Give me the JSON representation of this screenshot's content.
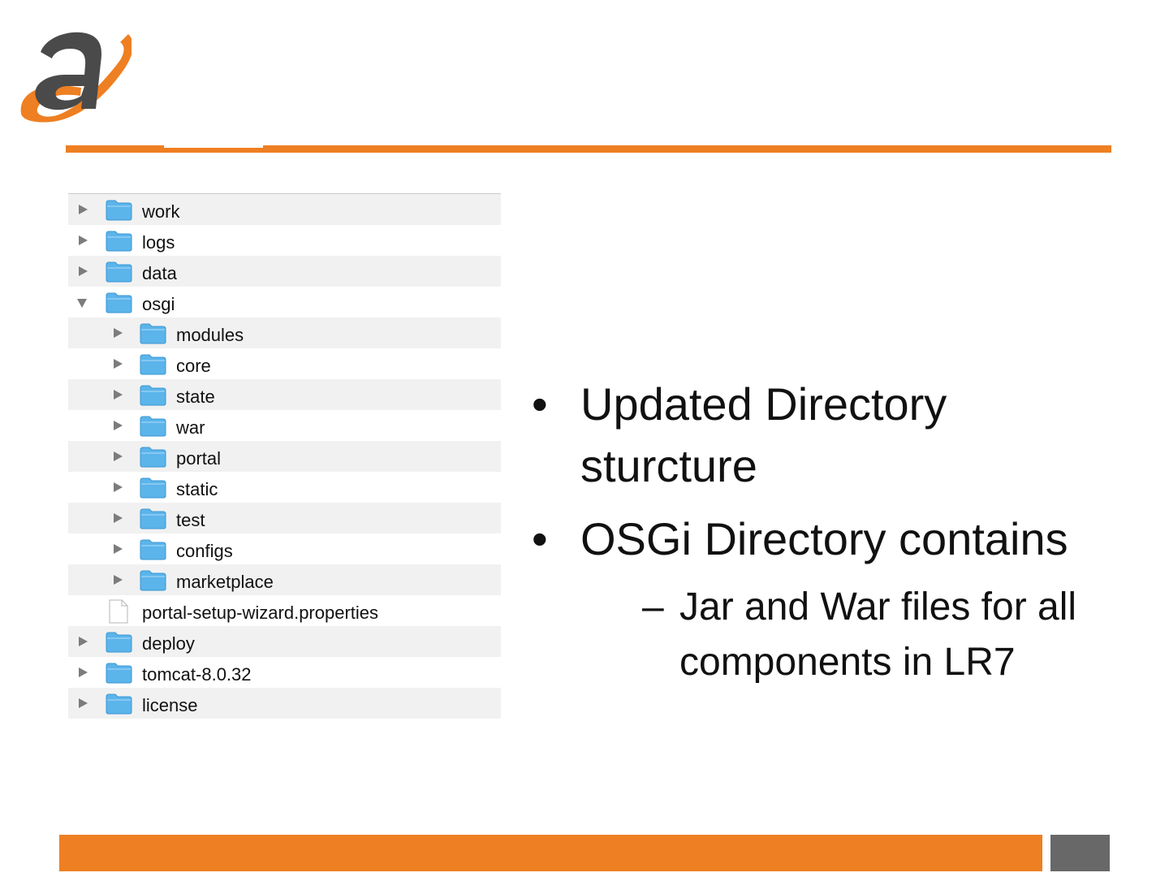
{
  "colors": {
    "accent": "#ee7f22",
    "logo_dark": "#4a4a4a",
    "folder": "#5bb4ea",
    "footer_box": "#686868"
  },
  "tree": {
    "rows": [
      {
        "label": "work",
        "type": "folder",
        "state": "collapsed"
      },
      {
        "label": "logs",
        "type": "folder",
        "state": "collapsed"
      },
      {
        "label": "data",
        "type": "folder",
        "state": "collapsed"
      },
      {
        "label": "osgi",
        "type": "folder",
        "state": "expanded"
      },
      {
        "label": "modules",
        "type": "folder",
        "state": "collapsed"
      },
      {
        "label": "core",
        "type": "folder",
        "state": "collapsed"
      },
      {
        "label": "state",
        "type": "folder",
        "state": "collapsed"
      },
      {
        "label": "war",
        "type": "folder",
        "state": "collapsed"
      },
      {
        "label": "portal",
        "type": "folder",
        "state": "collapsed"
      },
      {
        "label": "static",
        "type": "folder",
        "state": "collapsed"
      },
      {
        "label": "test",
        "type": "folder",
        "state": "collapsed"
      },
      {
        "label": "configs",
        "type": "folder",
        "state": "collapsed"
      },
      {
        "label": "marketplace",
        "type": "folder",
        "state": "collapsed"
      },
      {
        "label": "portal-setup-wizard.properties",
        "type": "file"
      },
      {
        "label": "deploy",
        "type": "folder",
        "state": "collapsed"
      },
      {
        "label": "tomcat-8.0.32",
        "type": "folder",
        "state": "collapsed"
      },
      {
        "label": "license",
        "type": "folder",
        "state": "collapsed"
      }
    ]
  },
  "bullets": [
    {
      "text": "Updated Directory sturcture"
    },
    {
      "text": "OSGi Directory contains",
      "sub": [
        "Jar and War files for all components in LR7"
      ]
    }
  ],
  "glyphs": {
    "bullet": "•",
    "dash": "–"
  }
}
